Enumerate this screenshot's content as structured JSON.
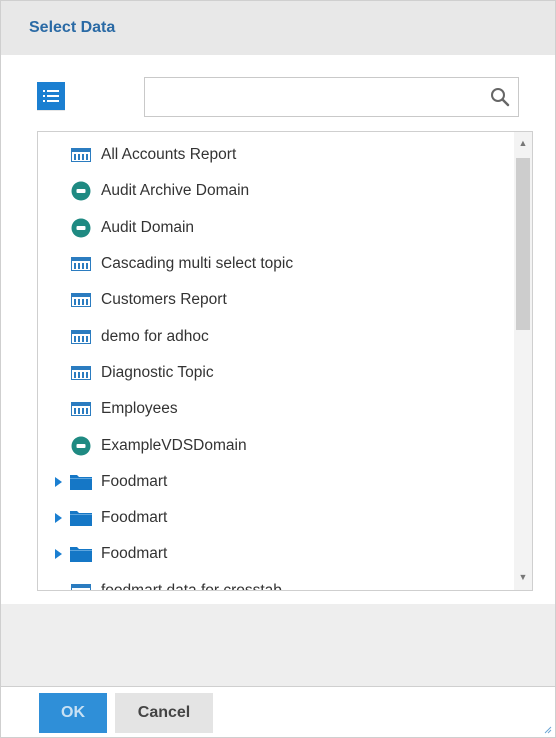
{
  "dialog": {
    "title": "Select Data"
  },
  "search": {
    "value": "",
    "placeholder": ""
  },
  "items": [
    {
      "label": "All Accounts Report",
      "icon": "report-table-icon"
    },
    {
      "label": "Audit Archive Domain",
      "icon": "domain-icon"
    },
    {
      "label": "Audit Domain",
      "icon": "domain-icon"
    },
    {
      "label": "Cascading multi select topic",
      "icon": "report-table-icon"
    },
    {
      "label": "Customers Report",
      "icon": "report-table-icon"
    },
    {
      "label": "demo for adhoc",
      "icon": "report-table-icon"
    },
    {
      "label": "Diagnostic Topic",
      "icon": "report-table-icon"
    },
    {
      "label": "Employees",
      "icon": "report-table-icon"
    },
    {
      "label": "ExampleVDSDomain",
      "icon": "domain-icon"
    },
    {
      "label": "Foodmart",
      "icon": "folder-icon",
      "expandable": true
    },
    {
      "label": "Foodmart",
      "icon": "folder-icon",
      "expandable": true
    },
    {
      "label": "Foodmart",
      "icon": "folder-icon",
      "expandable": true
    },
    {
      "label": "foodmart data for crosstab",
      "icon": "report-table-icon"
    }
  ],
  "footer": {
    "ok_label": "OK",
    "cancel_label": "Cancel"
  },
  "colors": {
    "accent": "#1b7fd1",
    "title": "#2a6aa5",
    "domain": "#1f8a82",
    "ok_button": "#2f8fd8"
  }
}
